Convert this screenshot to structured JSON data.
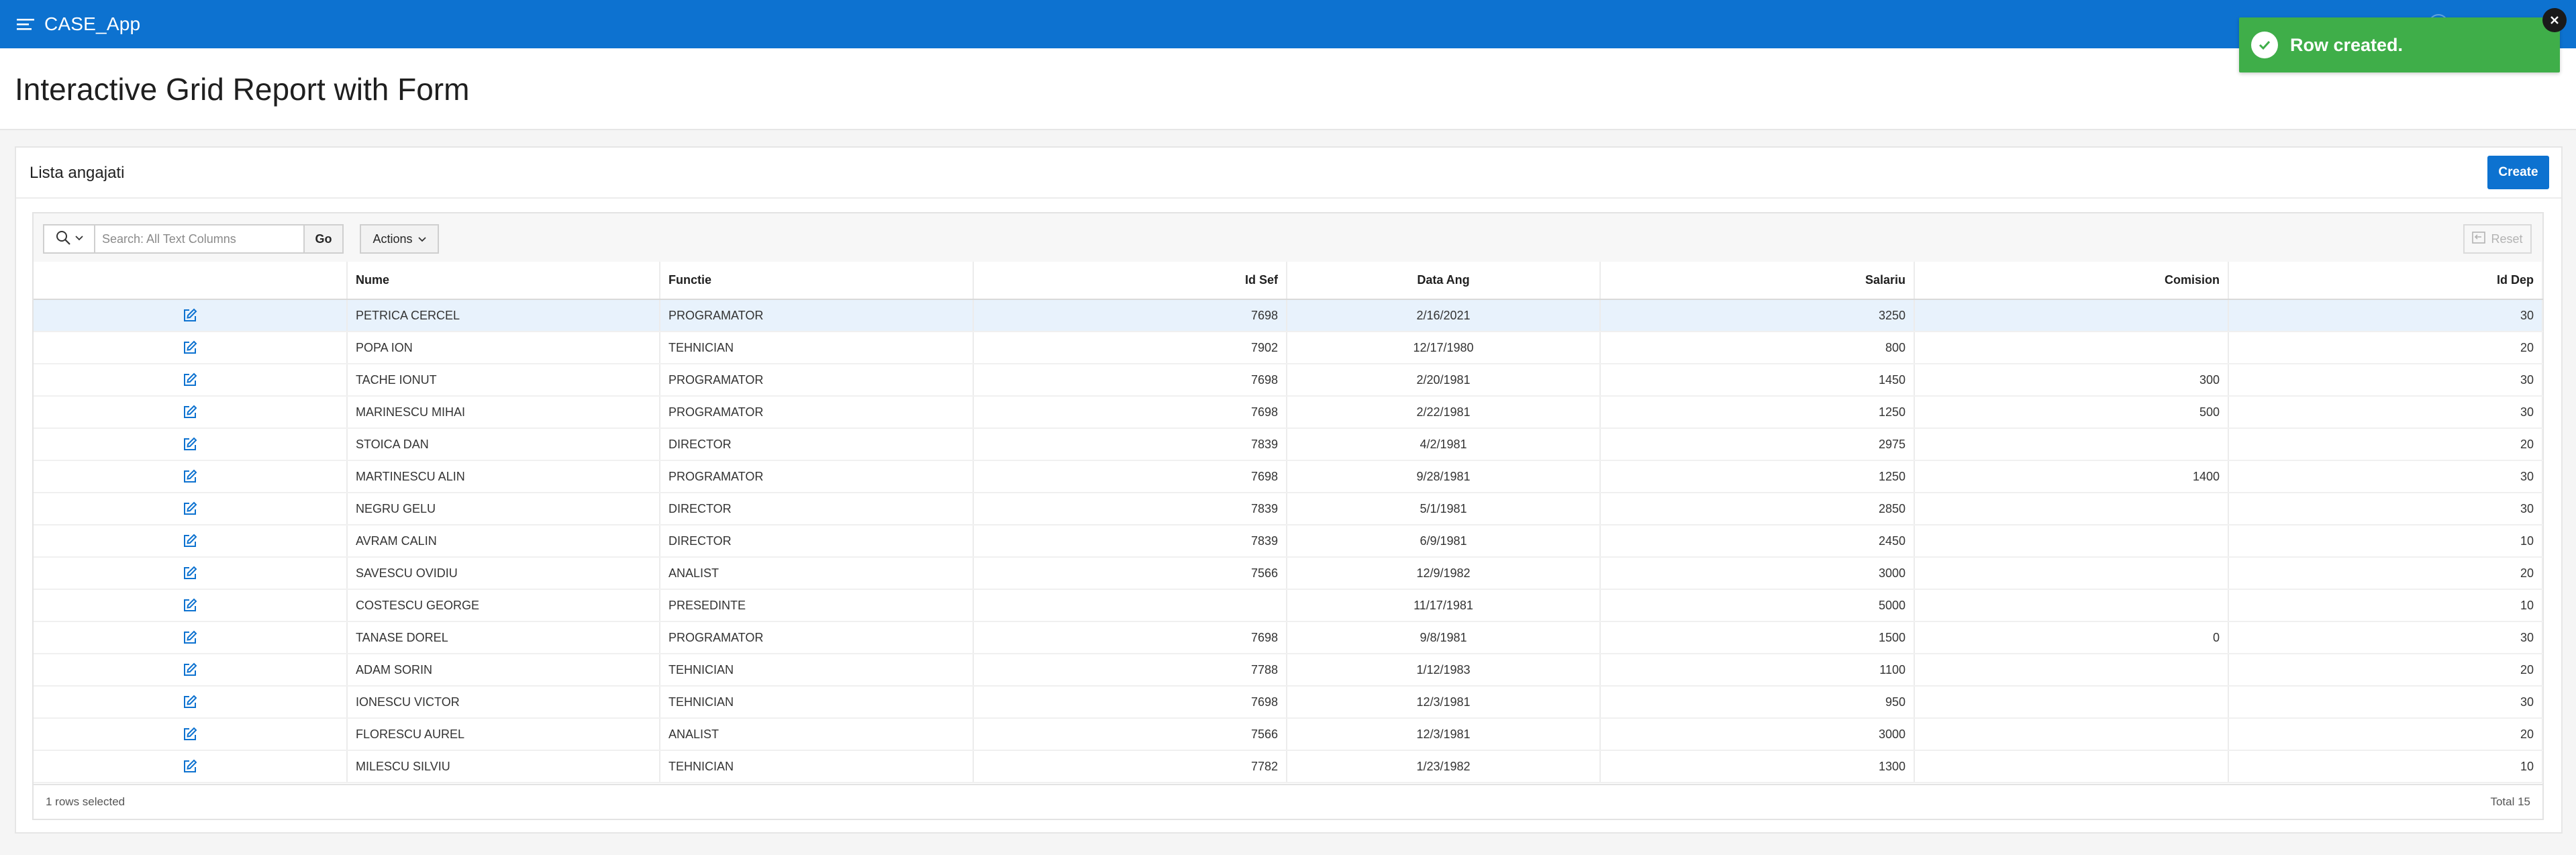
{
  "app": {
    "title": "CASE_App",
    "accent_color": "#0d72d0"
  },
  "page": {
    "title": "Interactive Grid Report with Form"
  },
  "region": {
    "title": "Lista angajati",
    "create_label": "Create"
  },
  "toolbar": {
    "search_placeholder": "Search: All Text Columns",
    "go_label": "Go",
    "actions_label": "Actions",
    "reset_label": "Reset"
  },
  "grid": {
    "columns": [
      "Nume",
      "Functie",
      "Id Sef",
      "Data Ang",
      "Salariu",
      "Comision",
      "Id Dep"
    ],
    "rows": [
      [
        "PETRICA CERCEL",
        "PROGRAMATOR",
        "7698",
        "2/16/2021",
        "3250",
        "",
        "30"
      ],
      [
        "POPA ION",
        "TEHNICIAN",
        "7902",
        "12/17/1980",
        "800",
        "",
        "20"
      ],
      [
        "TACHE IONUT",
        "PROGRAMATOR",
        "7698",
        "2/20/1981",
        "1450",
        "300",
        "30"
      ],
      [
        "MARINESCU MIHAI",
        "PROGRAMATOR",
        "7698",
        "2/22/1981",
        "1250",
        "500",
        "30"
      ],
      [
        "STOICA DAN",
        "DIRECTOR",
        "7839",
        "4/2/1981",
        "2975",
        "",
        "20"
      ],
      [
        "MARTINESCU ALIN",
        "PROGRAMATOR",
        "7698",
        "9/28/1981",
        "1250",
        "1400",
        "30"
      ],
      [
        "NEGRU GELU",
        "DIRECTOR",
        "7839",
        "5/1/1981",
        "2850",
        "",
        "30"
      ],
      [
        "AVRAM CALIN",
        "DIRECTOR",
        "7839",
        "6/9/1981",
        "2450",
        "",
        "10"
      ],
      [
        "SAVESCU OVIDIU",
        "ANALIST",
        "7566",
        "12/9/1982",
        "3000",
        "",
        "20"
      ],
      [
        "COSTESCU GEORGE",
        "PRESEDINTE",
        "",
        "11/17/1981",
        "5000",
        "",
        "10"
      ],
      [
        "TANASE DOREL",
        "PROGRAMATOR",
        "7698",
        "9/8/1981",
        "1500",
        "0",
        "30"
      ],
      [
        "ADAM SORIN",
        "TEHNICIAN",
        "7788",
        "1/12/1983",
        "1100",
        "",
        "20"
      ],
      [
        "IONESCU VICTOR",
        "TEHNICIAN",
        "7698",
        "12/3/1981",
        "950",
        "",
        "30"
      ],
      [
        "FLORESCU AUREL",
        "ANALIST",
        "7566",
        "12/3/1981",
        "3000",
        "",
        "20"
      ],
      [
        "MILESCU SILVIU",
        "TEHNICIAN",
        "7782",
        "1/23/1982",
        "1300",
        "",
        "10"
      ]
    ],
    "selected_row_index": 0,
    "footer_selected": "1 rows selected",
    "footer_total": "Total 15"
  },
  "toast": {
    "message": "Row created.",
    "color": "#3fae49"
  }
}
